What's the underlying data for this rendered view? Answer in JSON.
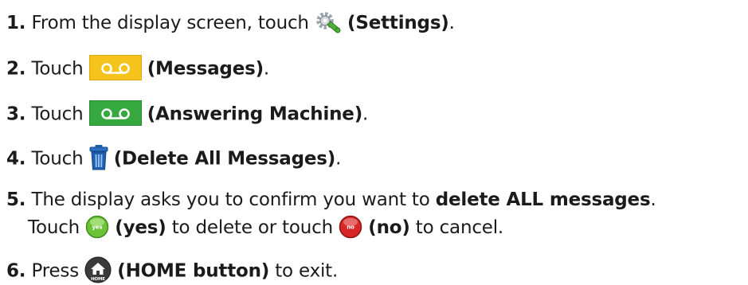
{
  "steps": [
    {
      "num": "1.",
      "pre": "From the display screen, touch",
      "icon": "settings-icon",
      "label": "(Settings)",
      "post": "."
    },
    {
      "num": "2.",
      "pre": "Touch",
      "icon": "messages-icon",
      "label": "(Messages)",
      "post": "."
    },
    {
      "num": "3.",
      "pre": "Touch",
      "icon": "answering-machine-icon",
      "label": "(Answering Machine)",
      "post": "."
    },
    {
      "num": "4.",
      "pre": "Touch",
      "icon": "trash-icon",
      "label": "(Delete All Messages)",
      "post": "."
    },
    {
      "num": "5.",
      "line1_pre": "The display asks you to confirm you want to",
      "line1_bold": "delete ALL messages",
      "line1_post": ".",
      "line2_pre": "Touch",
      "yes_icon_text": "yes",
      "yes_label": "(yes)",
      "mid": "to delete or touch",
      "no_icon_text": "no",
      "no_label": "(no)",
      "line2_post": "to cancel."
    },
    {
      "num": "6.",
      "pre": "Press",
      "icon": "home-icon",
      "icon_text": "HOME",
      "label": "(HOME button)",
      "post": "to exit."
    }
  ],
  "colors": {
    "text": "#1b1b1b",
    "messages_fill": "#f6c21c",
    "answering_fill": "#35a83f",
    "trash_fill": "#1f5fb0",
    "yes_fill": "#6cc236",
    "no_fill": "#d82727",
    "home_fill": "#3a3a3a"
  }
}
